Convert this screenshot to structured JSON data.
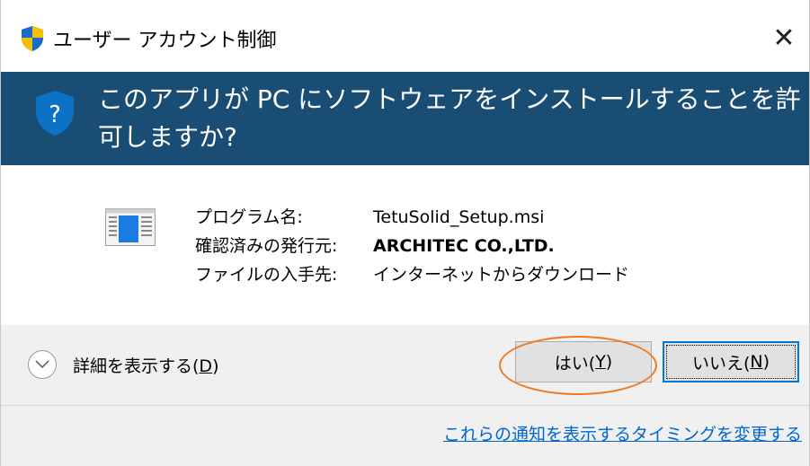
{
  "window": {
    "title": "ユーザー アカウント制御",
    "close_glyph": "✕"
  },
  "banner": {
    "question": "このアプリが PC にソフトウェアをインストールすることを許可しますか?",
    "icon": "uac-shield-question-icon"
  },
  "program": {
    "icon": "msi-installer-icon",
    "rows": [
      {
        "label": "プログラム名:",
        "value": "TetuSolid_Setup.msi",
        "bold": false
      },
      {
        "label": "確認済みの発行元:",
        "value": "ARCHITEC CO.,LTD.",
        "bold": true
      },
      {
        "label": "ファイルの入手先:",
        "value": "インターネットからダウンロード",
        "bold": false
      }
    ]
  },
  "actions": {
    "details_label": "詳細を表示する(",
    "details_key": "D",
    "details_suffix": ")",
    "yes_label": "はい(",
    "yes_key": "Y",
    "yes_suffix": ")",
    "no_label": "いいえ(",
    "no_key": "N",
    "no_suffix": ")",
    "footer_link": "これらの通知を表示するタイミングを変更する"
  },
  "colors": {
    "banner_bg": "#1a4d73",
    "highlight": "#f07a23",
    "link": "#0066cc",
    "focus_border": "#0078d7"
  }
}
